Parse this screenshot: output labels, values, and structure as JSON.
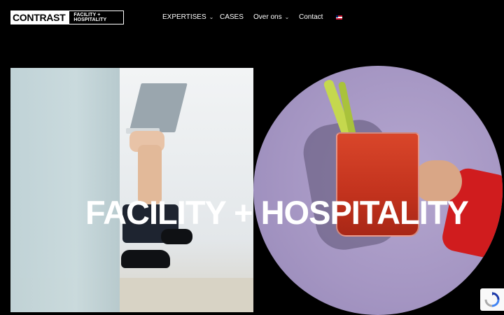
{
  "brand": {
    "name": "CONTRAST",
    "subtitle": "FACILITY + HOSPITALITY"
  },
  "nav": {
    "items": [
      {
        "label": "EXPERTISES",
        "has_dropdown": true
      },
      {
        "label": "CASES",
        "has_dropdown": false
      },
      {
        "label": "Over ons",
        "has_dropdown": true
      },
      {
        "label": "Contact",
        "has_dropdown": false
      }
    ],
    "chevron": "⌄",
    "language_icon": "uk-flag-icon"
  },
  "hero": {
    "headline": "FACILITY + HOSPITALITY"
  },
  "colors": {
    "background": "#000000",
    "circle": "#a495c2",
    "accent_red": "#d01c1e"
  },
  "recaptcha": {
    "icon": "recaptcha-icon"
  }
}
